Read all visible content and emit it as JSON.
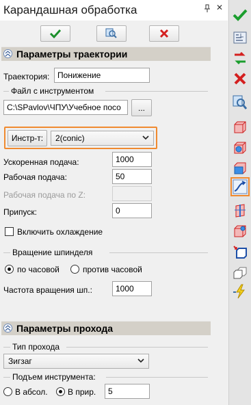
{
  "window": {
    "title": "Карандашная обработка",
    "pin_glyph": "📌",
    "close_glyph": "✕"
  },
  "toolbar": {
    "ok_icon": "check-icon",
    "preview_icon": "magnifier-icon",
    "cancel_icon": "close-icon"
  },
  "trajectory_section": {
    "title": "Параметры траектории",
    "trajectory_label": "Траектория:",
    "trajectory_value": "Понижение",
    "tool_file_label": "Файл с инструментом",
    "tool_file_path": "C:\\SPavlov\\ЧПУ\\Учебное посо",
    "browse_label": "...",
    "tool_button_label": "Инстр-т:",
    "tool_selected": "2(conic)",
    "rapid_feed_label": "Ускоренная подача:",
    "rapid_feed_value": "1000",
    "work_feed_label": "Рабочая подача:",
    "work_feed_value": "50",
    "z_feed_label": "Рабочая подача по Z:",
    "z_feed_value": "",
    "allowance_label": "Припуск:",
    "allowance_value": "0",
    "coolant_label": "Включить охлаждение",
    "coolant_checked": false,
    "spindle_group_label": "Вращение шпинделя",
    "cw_label": "по часовой",
    "ccw_label": "против часовой",
    "spindle_direction": "по часовой",
    "spindle_speed_label": "Частота вращения шп.:",
    "spindle_speed_value": "1000"
  },
  "pass_section": {
    "title": "Параметры прохода",
    "pass_type_group_label": "Тип прохода",
    "pass_type_value": "Зигзаг",
    "lift_group_label": "Подъем инструмента:",
    "absolute_label": "В абсол.",
    "relative_label": "В прир.",
    "lift_mode": "В прир.",
    "lift_value": "5"
  },
  "right_toolbar": {
    "items": [
      "check-icon",
      "text-block-icon",
      "arrow-switch-icon",
      "close-icon",
      "magnifier-icon",
      "box-icon",
      "box-face-icon",
      "box-side-icon",
      "curve-arrow-icon",
      "plane-icon",
      "box-corner-icon",
      "box-move-icon",
      "box-copy-icon",
      "lightning-icon"
    ],
    "selected": "curve-arrow-icon"
  }
}
